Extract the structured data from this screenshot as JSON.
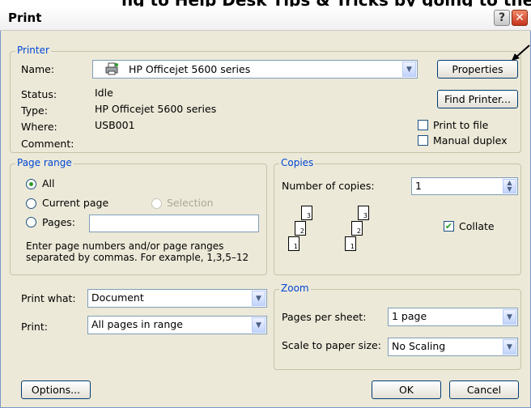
{
  "dialog": {
    "title": "Print"
  },
  "printer": {
    "group_label": "Printer",
    "name_label": "Name:",
    "name_value": "HP Officejet 5600 series",
    "status_label": "Status:",
    "status_value": "Idle",
    "type_label": "Type:",
    "type_value": "HP Officejet 5600 series",
    "where_label": "Where:",
    "where_value": "USB001",
    "comment_label": "Comment:",
    "properties_button": "Properties",
    "find_printer_button": "Find Printer...",
    "print_to_file": "Print to file",
    "manual_duplex": "Manual duplex"
  },
  "page_range": {
    "group_label": "Page range",
    "all": "All",
    "current_page": "Current page",
    "selection": "Selection",
    "pages": "Pages:",
    "pages_value": "",
    "hint": "Enter page numbers and/or page ranges separated by commas.  For example, 1,3,5–12"
  },
  "copies": {
    "group_label": "Copies",
    "number_label": "Number of copies:",
    "number_value": "1",
    "collate": "Collate"
  },
  "print_what": {
    "label": "Print what:",
    "value": "Document"
  },
  "print": {
    "label": "Print:",
    "value": "All pages in range"
  },
  "zoom": {
    "group_label": "Zoom",
    "pages_per_sheet_label": "Pages per sheet:",
    "pages_per_sheet_value": "1 page",
    "scale_label": "Scale to paper size:",
    "scale_value": "No Scaling"
  },
  "buttons": {
    "options": "Options...",
    "ok": "OK",
    "cancel": "Cancel"
  }
}
